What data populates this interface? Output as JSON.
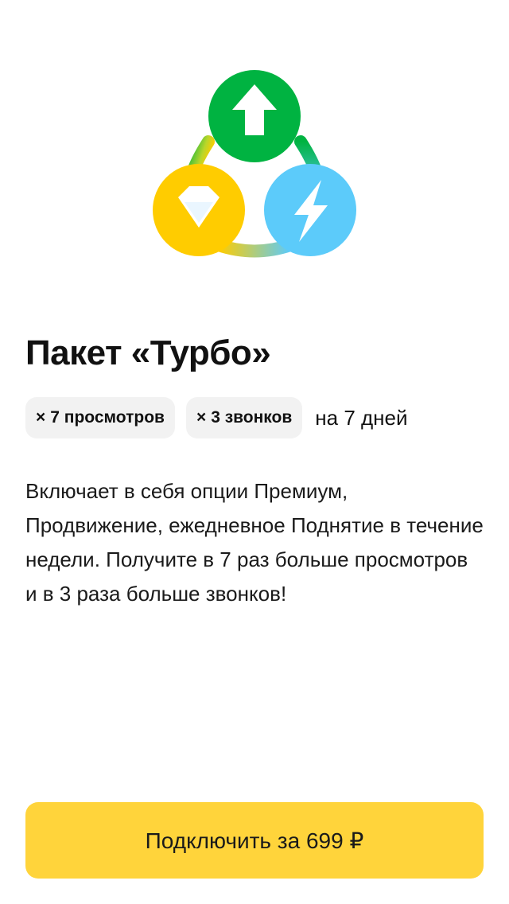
{
  "hero": {
    "icon": "turbo-package-icon",
    "parts": [
      "arrow-up-icon",
      "diamond-icon",
      "lightning-icon"
    ],
    "colors": {
      "green": "#00b341",
      "yellow": "#ffcc00",
      "blue": "#5ccbfa",
      "arrow": "#ffffff"
    }
  },
  "title": "Пакет «Турбо»",
  "badges": [
    {
      "mult": "×",
      "text": "7 просмотров"
    },
    {
      "mult": "×",
      "text": "3 звонков"
    }
  ],
  "duration": "на 7 дней",
  "description": "Включает в себя опции Премиум, Продвижение, ежедневное Поднятие в течение недели. Получите в 7 раз больше просмотров и в 3 раза больше звонков!",
  "cta": {
    "label": "Подключить за 699 ₽",
    "color": "#ffd43b"
  }
}
